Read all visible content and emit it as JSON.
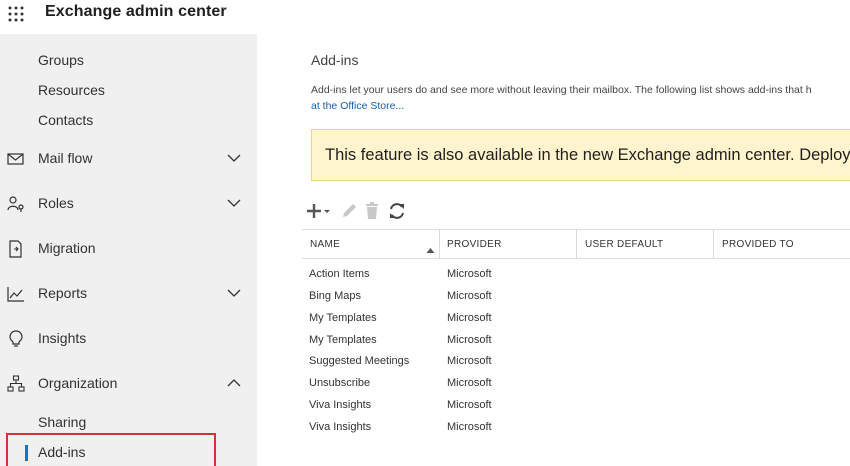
{
  "header": {
    "app_title": "Exchange admin center",
    "waffle_icon": "app-launcher-icon"
  },
  "sidebar": {
    "sub_items_top": [
      {
        "label": "Groups"
      },
      {
        "label": "Resources"
      },
      {
        "label": "Contacts"
      }
    ],
    "items": [
      {
        "label": "Mail flow",
        "icon": "mail-icon",
        "expandable": true,
        "expanded": false
      },
      {
        "label": "Roles",
        "icon": "roles-icon",
        "expandable": true,
        "expanded": false
      },
      {
        "label": "Migration",
        "icon": "migration-icon",
        "expandable": false
      },
      {
        "label": "Reports",
        "icon": "reports-icon",
        "expandable": true,
        "expanded": false
      },
      {
        "label": "Insights",
        "icon": "insights-icon",
        "expandable": false
      },
      {
        "label": "Organization",
        "icon": "organization-icon",
        "expandable": true,
        "expanded": true
      }
    ],
    "sub_items_org": [
      {
        "label": "Sharing"
      },
      {
        "label": "Add-ins",
        "selected": true
      }
    ],
    "selection_color": "#d13438",
    "accent_color": "#0078d4"
  },
  "main": {
    "title": "Add-ins",
    "description": "Add-ins let your users do and see more without leaving their mailbox. The following list shows add-ins that h",
    "description_link": "at the Office Store...",
    "banner": {
      "text": "This feature is also available in the new Exchange admin center. Deploy",
      "background": "#fff4ce"
    },
    "toolbar": {
      "add": "add-icon",
      "edit": "edit-icon",
      "delete": "delete-icon",
      "refresh": "refresh-icon"
    },
    "table": {
      "columns": [
        "NAME",
        "PROVIDER",
        "USER DEFAULT",
        "PROVIDED TO"
      ],
      "sorted_column": "NAME",
      "sort_direction": "ascending",
      "rows": [
        {
          "name": "Action Items",
          "provider": "Microsoft"
        },
        {
          "name": "Bing Maps",
          "provider": "Microsoft"
        },
        {
          "name": "My Templates",
          "provider": "Microsoft"
        },
        {
          "name": "My Templates",
          "provider": "Microsoft"
        },
        {
          "name": "Suggested Meetings",
          "provider": "Microsoft"
        },
        {
          "name": "Unsubscribe",
          "provider": "Microsoft"
        },
        {
          "name": "Viva Insights",
          "provider": "Microsoft"
        },
        {
          "name": "Viva Insights",
          "provider": "Microsoft"
        }
      ]
    }
  }
}
